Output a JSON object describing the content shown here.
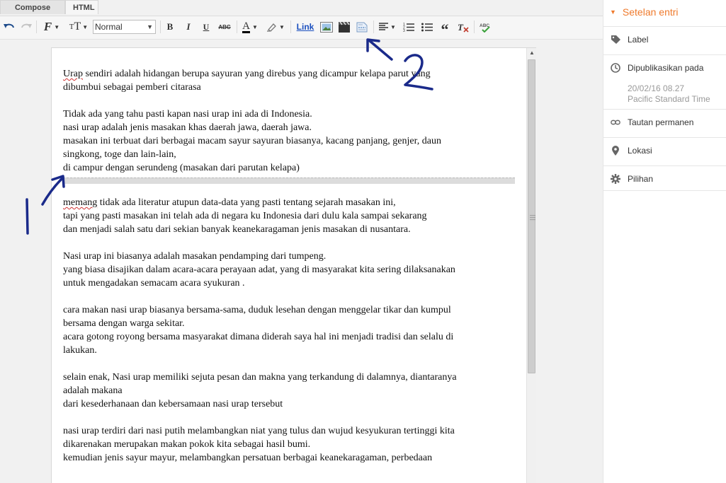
{
  "tabs": {
    "compose": "Compose",
    "html": "HTML"
  },
  "toolbar": {
    "format_select": "Normal",
    "bold": "B",
    "italic": "I",
    "underline": "U",
    "strike": "ABC",
    "font_color": "A",
    "link": "Link"
  },
  "document": {
    "paragraphs": [
      {
        "lines": [
          "Urap sendiri adalah hidangan berupa sayuran yang direbus yang dicampur kelapa parut yang",
          "dibumbui sebagai pemberi citarasa"
        ]
      },
      {
        "lines": [
          "Tidak ada yang tahu pasti kapan nasi urap ini ada di Indonesia.",
          "nasi urap adalah jenis masakan khas daerah jawa, daerah jawa.",
          "masakan ini terbuat dari berbagai macam sayur sayuran biasanya, kacang panjang, genjer, daun",
          "singkong, toge dan lain-lain,",
          "di campur dengan serundeng (masakan dari parutan kelapa)"
        ]
      },
      {
        "lines": [
          "memang tidak ada literatur atupun data-data yang pasti tentang sejarah masakan ini,",
          "tapi yang pasti masakan ini telah ada di negara ku Indonesia dari dulu kala sampai sekarang",
          "dan menjadi salah satu  dari sekian banyak keanekaragaman jenis masakan di nusantara."
        ]
      },
      {
        "lines": [
          "Nasi urap ini biasanya adalah masakan pendamping dari tumpeng.",
          "yang biasa disajikan dalam acara-acara  perayaan adat, yang di masyarakat kita sering dilaksanakan",
          "untuk mengadakan semacam acara syukuran ."
        ]
      },
      {
        "lines": [
          "cara makan nasi urap biasanya bersama-sama, duduk lesehan dengan menggelar tikar dan kumpul",
          "bersama dengan warga sekitar.",
          "acara gotong royong bersama masyarakat dimana diderah saya hal ini menjadi tradisi dan selalu di",
          "lakukan."
        ]
      },
      {
        "lines": [
          "selain enak, Nasi urap memiliki sejuta pesan dan makna yang terkandung di dalamnya, diantaranya",
          "adalah makana",
          "dari kesederhanaan dan kebersamaan nasi urap tersebut"
        ]
      },
      {
        "lines": [
          "nasi urap terdiri dari nasi putih melambangkan niat yang tulus dan wujud kesyukuran tertinggi kita",
          "dikarenakan merupakan makan pokok kita  sebagai hasil bumi.",
          "kemudian  jenis sayur mayur, melambangkan persatuan berbagai keanekaragaman, perbedaan"
        ]
      }
    ]
  },
  "sidebar": {
    "title": "Setelan entri",
    "label": "Label",
    "published": "Dipublikasikan pada",
    "published_date": "20/02/16 08.27",
    "published_tz": "Pacific Standard Time",
    "permalink": "Tautan permanen",
    "location": "Lokasi",
    "options": "Pilihan"
  },
  "annotations": {
    "one": "1",
    "two": "2"
  },
  "colors": {
    "accent": "#ef7a2c",
    "link": "#1a4fbf",
    "annotation_ink": "#1a2a8a"
  }
}
